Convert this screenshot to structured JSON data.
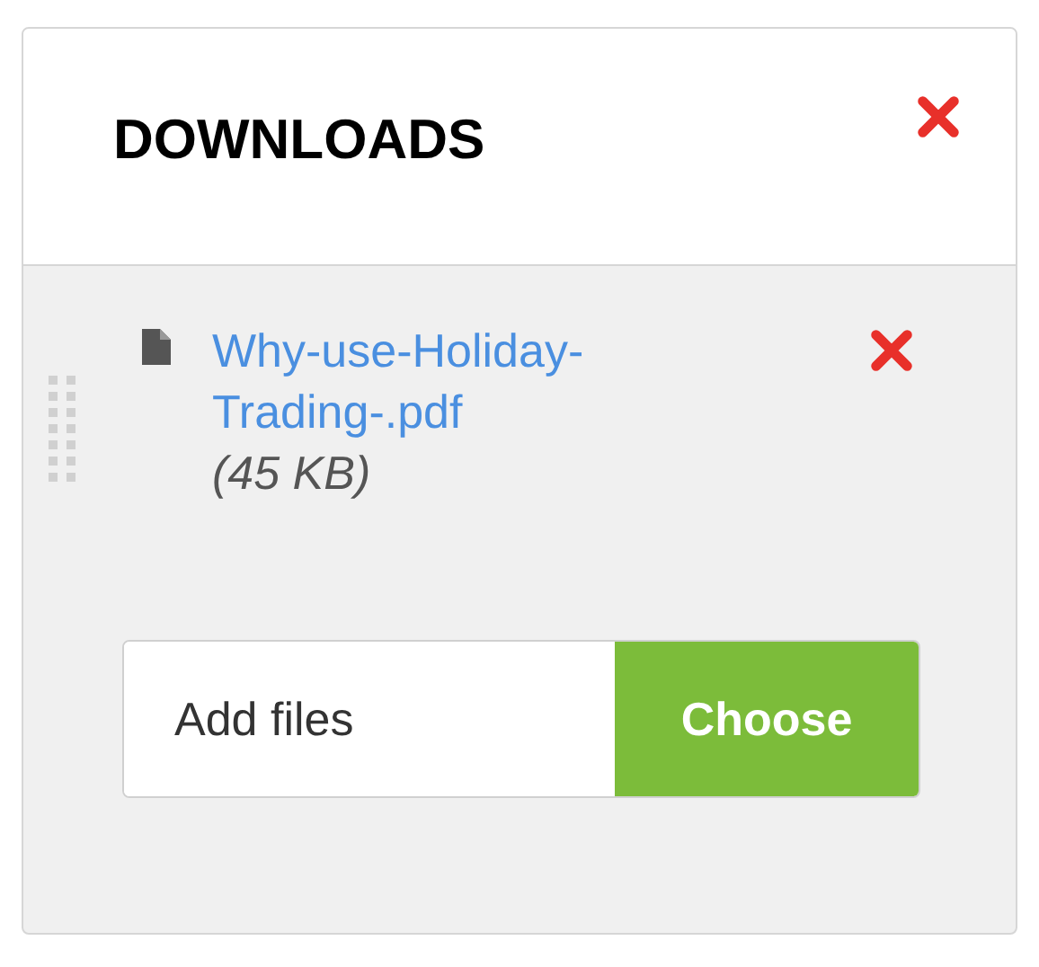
{
  "panel": {
    "title": "DOWNLOADS"
  },
  "files": [
    {
      "name": "Why-use-Holiday-Trading-.pdf",
      "size": "(45 KB)"
    }
  ],
  "upload": {
    "placeholder": "Add files",
    "button": "Choose"
  }
}
